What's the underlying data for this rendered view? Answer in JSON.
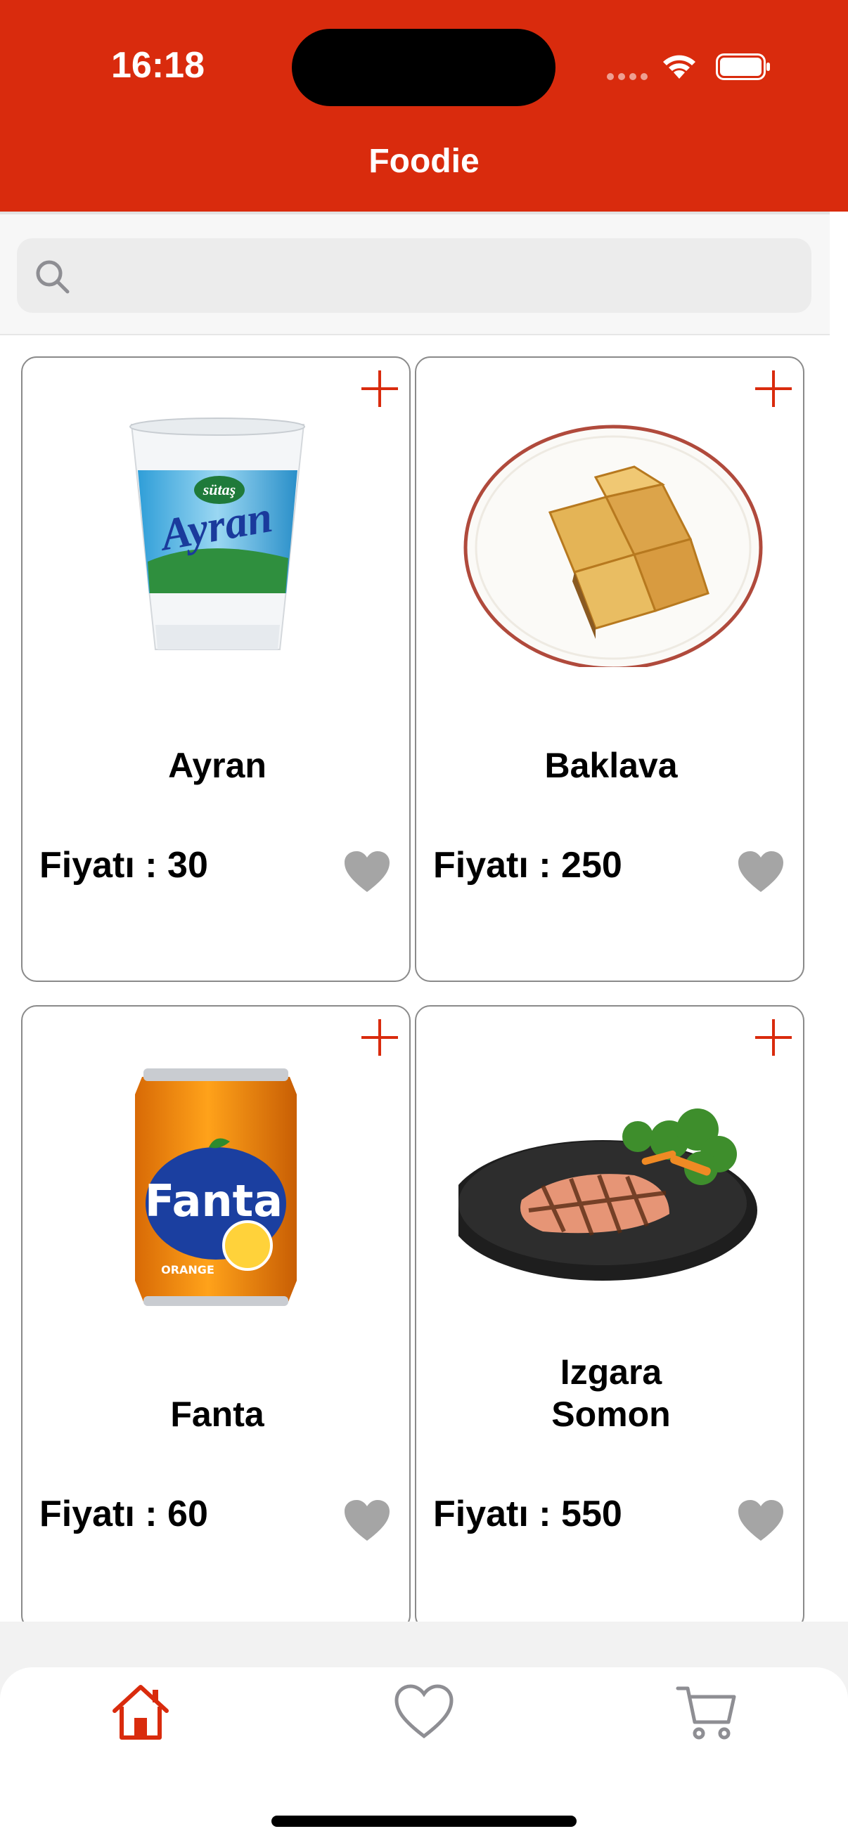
{
  "status_bar": {
    "time": "16:18"
  },
  "app": {
    "title": "Foodie",
    "accent_color": "#d92b0d"
  },
  "search": {
    "placeholder": "",
    "value": ""
  },
  "products": [
    {
      "name": "Ayran",
      "price_text": "Fiyatı : 30",
      "image": "ayran-cup",
      "favorite": false
    },
    {
      "name": "Baklava",
      "price_text": "Fiyatı : 250",
      "image": "baklava-plate",
      "favorite": false
    },
    {
      "name": "Fanta",
      "price_text": "Fiyatı : 60",
      "image": "fanta-can",
      "favorite": false
    },
    {
      "name": "Izgara\nSomon",
      "price_text": "Fiyatı : 550",
      "image": "grilled-salmon-plate",
      "favorite": false
    }
  ],
  "product_image_text": {
    "ayran_brand": "sütaş",
    "ayran_label": "Ayran",
    "fanta_label": "Fanta",
    "fanta_flavor": "ORANGE"
  },
  "tabs": [
    {
      "icon": "home-icon",
      "active": true
    },
    {
      "icon": "heart-icon",
      "active": false
    },
    {
      "icon": "cart-icon",
      "active": false
    }
  ]
}
